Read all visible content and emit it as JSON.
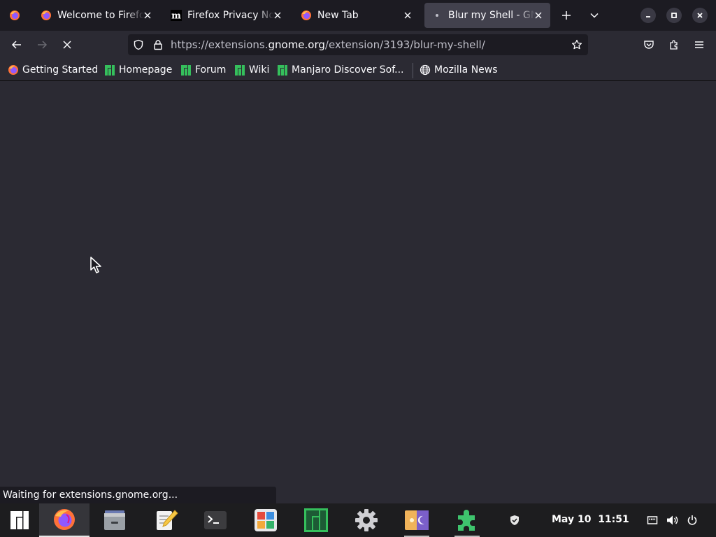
{
  "tabs": [
    {
      "label": "Welcome to Firefox",
      "icon": "firefox-icon",
      "active": false
    },
    {
      "label": "Firefox Privacy Notice",
      "icon": "mozilla-m-icon",
      "active": false
    },
    {
      "label": "New Tab",
      "icon": "firefox-icon",
      "active": false
    },
    {
      "label": "Blur my Shell - GNOME Shell Extensions",
      "icon": "loading-dot-icon",
      "active": true
    }
  ],
  "navbar": {
    "url_prefix": "https://extensions.",
    "url_host": "gnome.org",
    "url_path": "/extension/3193/blur-my-shell/"
  },
  "bookmarks": [
    {
      "label": "Getting Started",
      "icon": "firefox-icon"
    },
    {
      "label": "Homepage",
      "icon": "manjaro-icon"
    },
    {
      "label": "Forum",
      "icon": "manjaro-icon"
    },
    {
      "label": "Wiki",
      "icon": "manjaro-icon"
    },
    {
      "label": "Manjaro Discover Sof...",
      "icon": "manjaro-icon"
    },
    {
      "label": "Mozilla News",
      "icon": "globe-icon"
    }
  ],
  "status": {
    "text": "Waiting for extensions.gnome.org..."
  },
  "taskbar": {
    "apps": [
      "activities-icon",
      "firefox-icon",
      "files-icon",
      "text-editor-icon",
      "terminal-icon",
      "software-icon",
      "manjaro-hello-icon",
      "settings-icon",
      "theme-switcher-icon",
      "extensions-icon"
    ],
    "date": "May 10",
    "time": "11:51"
  },
  "colors": {
    "tabstrip_bg": "#1c1b22",
    "toolbar_bg": "#2b2a33",
    "active_tab_bg": "#42414d",
    "manjaro_green": "#35bf5c",
    "taskbar_bg": "#1d1d1f"
  }
}
